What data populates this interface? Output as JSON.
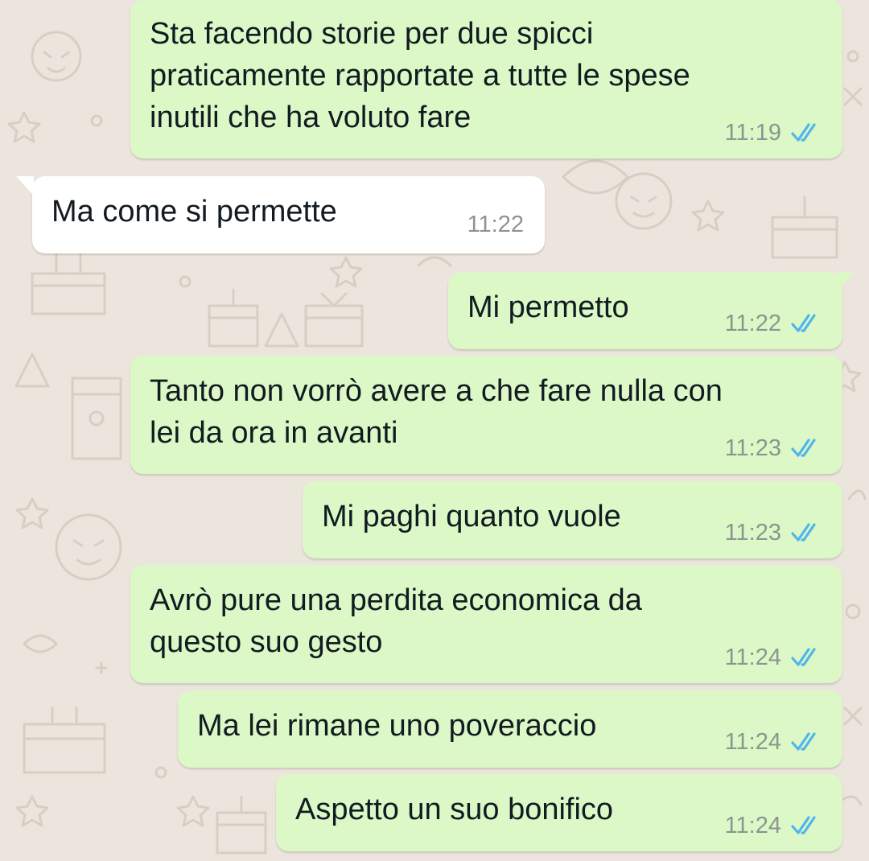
{
  "colors": {
    "wallpaper": "#ece5dd",
    "outgoing_bubble": "#dcf8c6",
    "incoming_bubble": "#ffffff",
    "read_tick": "#4fb6ec",
    "timestamp": "#8c958f"
  },
  "messages": [
    {
      "direction": "outgoing",
      "text": "Sta facendo storie per due spicci\npraticamente rapportate a tutte le spese\ninutili che ha voluto fare",
      "time": "11:19",
      "status": "read",
      "status_icon": "double-check-icon"
    },
    {
      "direction": "incoming",
      "text": "Ma come si permette",
      "time": "11:22"
    },
    {
      "direction": "outgoing",
      "text": "Mi permetto",
      "time": "11:22",
      "status": "read",
      "status_icon": "double-check-icon"
    },
    {
      "direction": "outgoing",
      "text": "Tanto non vorrò avere a che fare nulla con\nlei da ora in avanti",
      "time": "11:23",
      "status": "read",
      "status_icon": "double-check-icon"
    },
    {
      "direction": "outgoing",
      "text": "Mi paghi quanto vuole",
      "time": "11:23",
      "status": "read",
      "status_icon": "double-check-icon"
    },
    {
      "direction": "outgoing",
      "text": "Avrò pure una perdita economica da\nquesto suo gesto",
      "time": "11:24",
      "status": "read",
      "status_icon": "double-check-icon"
    },
    {
      "direction": "outgoing",
      "text": "Ma lei rimane uno poveraccio",
      "time": "11:24",
      "status": "read",
      "status_icon": "double-check-icon"
    },
    {
      "direction": "outgoing",
      "text": "Aspetto un suo bonifico",
      "time": "11:24",
      "status": "read",
      "status_icon": "double-check-icon"
    }
  ]
}
